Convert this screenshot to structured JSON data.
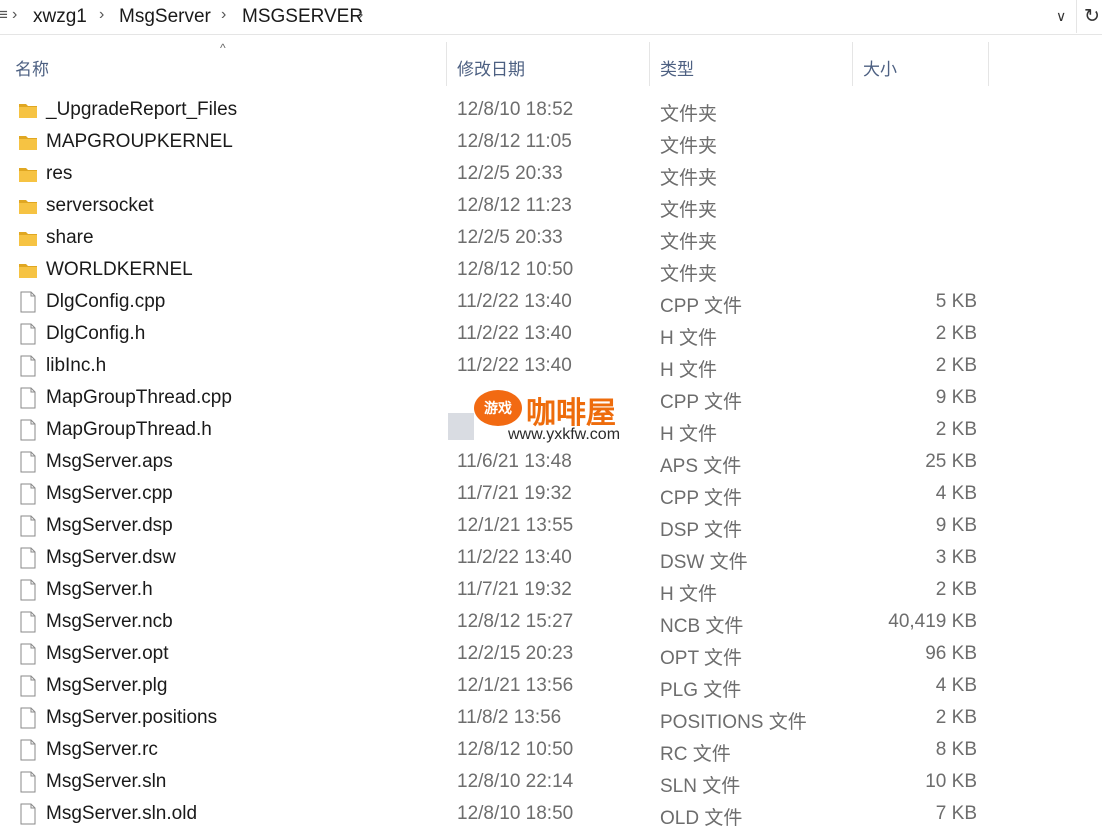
{
  "address": {
    "left_stub": "≡",
    "crumbs": [
      "xwzg1",
      "MsgServer",
      "MSGSERVER"
    ],
    "separator": "›",
    "dropdown_icon": "chevron-down-icon",
    "refresh_icon": "refresh-icon",
    "dropdown_glyph": "∨",
    "refresh_glyph": "↻"
  },
  "columns": {
    "name": "名称",
    "date": "修改日期",
    "type": "类型",
    "size": "大小",
    "sort_glyph": "^"
  },
  "files": [
    {
      "name": "_UpgradeReport_Files",
      "date": "12/8/10 18:52",
      "type": "文件夹",
      "size": "",
      "kind": "folder"
    },
    {
      "name": "MAPGROUPKERNEL",
      "date": "12/8/12 11:05",
      "type": "文件夹",
      "size": "",
      "kind": "folder"
    },
    {
      "name": "res",
      "date": "12/2/5 20:33",
      "type": "文件夹",
      "size": "",
      "kind": "folder"
    },
    {
      "name": "serversocket",
      "date": "12/8/12 11:23",
      "type": "文件夹",
      "size": "",
      "kind": "folder"
    },
    {
      "name": "share",
      "date": "12/2/5 20:33",
      "type": "文件夹",
      "size": "",
      "kind": "folder"
    },
    {
      "name": "WORLDKERNEL",
      "date": "12/8/12 10:50",
      "type": "文件夹",
      "size": "",
      "kind": "folder"
    },
    {
      "name": "DlgConfig.cpp",
      "date": "11/2/22 13:40",
      "type": "CPP 文件",
      "size": "5 KB",
      "kind": "file"
    },
    {
      "name": "DlgConfig.h",
      "date": "11/2/22 13:40",
      "type": "H 文件",
      "size": "2 KB",
      "kind": "file"
    },
    {
      "name": "libInc.h",
      "date": "11/2/22 13:40",
      "type": "H 文件",
      "size": "2 KB",
      "kind": "file"
    },
    {
      "name": "MapGroupThread.cpp",
      "date": "",
      "type": "CPP 文件",
      "size": "9 KB",
      "kind": "file"
    },
    {
      "name": "MapGroupThread.h",
      "date": "",
      "type": "H 文件",
      "size": "2 KB",
      "kind": "file"
    },
    {
      "name": "MsgServer.aps",
      "date": "11/6/21 13:48",
      "type": "APS 文件",
      "size": "25 KB",
      "kind": "file"
    },
    {
      "name": "MsgServer.cpp",
      "date": "11/7/21 19:32",
      "type": "CPP 文件",
      "size": "4 KB",
      "kind": "file"
    },
    {
      "name": "MsgServer.dsp",
      "date": "12/1/21 13:55",
      "type": "DSP 文件",
      "size": "9 KB",
      "kind": "file"
    },
    {
      "name": "MsgServer.dsw",
      "date": "11/2/22 13:40",
      "type": "DSW 文件",
      "size": "3 KB",
      "kind": "file"
    },
    {
      "name": "MsgServer.h",
      "date": "11/7/21 19:32",
      "type": "H 文件",
      "size": "2 KB",
      "kind": "file"
    },
    {
      "name": "MsgServer.ncb",
      "date": "12/8/12 15:27",
      "type": "NCB 文件",
      "size": "40,419 KB",
      "kind": "file"
    },
    {
      "name": "MsgServer.opt",
      "date": "12/2/15 20:23",
      "type": "OPT 文件",
      "size": "96 KB",
      "kind": "file"
    },
    {
      "name": "MsgServer.plg",
      "date": "12/1/21 13:56",
      "type": "PLG 文件",
      "size": "4 KB",
      "kind": "file"
    },
    {
      "name": "MsgServer.positions",
      "date": "11/8/2 13:56",
      "type": "POSITIONS 文件",
      "size": "2 KB",
      "kind": "file"
    },
    {
      "name": "MsgServer.rc",
      "date": "12/8/12 10:50",
      "type": "RC 文件",
      "size": "8 KB",
      "kind": "file"
    },
    {
      "name": "MsgServer.sln",
      "date": "12/8/10 22:14",
      "type": "SLN 文件",
      "size": "10 KB",
      "kind": "file"
    },
    {
      "name": "MsgServer.sln.old",
      "date": "12/8/10 18:50",
      "type": "OLD 文件",
      "size": "7 KB",
      "kind": "file"
    }
  ],
  "watermark": {
    "badge": "游戏",
    "brand": "咖啡屋",
    "url": "www.yxkfw.com"
  },
  "colors": {
    "header_text": "#4d6082",
    "folder": "#f6c343",
    "folder_dark": "#e0a722",
    "watermark_orange": "#f26a12"
  }
}
